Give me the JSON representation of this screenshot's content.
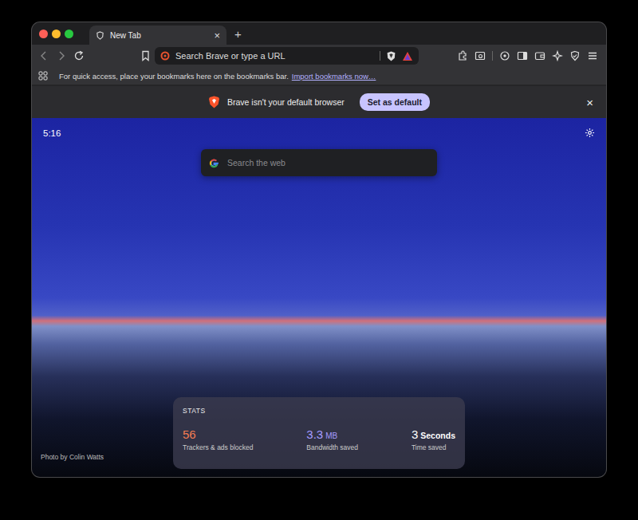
{
  "tabs": [
    {
      "label": "New Tab",
      "selected": true,
      "close": "×"
    }
  ],
  "new_tab_button": "+",
  "address_bar": {
    "placeholder": "Search Brave or type a URL"
  },
  "bookmarks_bar": {
    "message": "For quick access, place your bookmarks here on the bookmarks bar.",
    "link": "Import bookmarks now…"
  },
  "infobar": {
    "message": "Brave isn't your default browser",
    "button": "Set as default",
    "close": "×"
  },
  "new_tab_page": {
    "clock": "5:16",
    "search": {
      "placeholder": "Search the web"
    },
    "stats": {
      "title": "STATS",
      "items": [
        {
          "value": "56",
          "label": "Trackers & ads blocked",
          "color": "#f47c52"
        },
        {
          "value": "3.3",
          "unit": "MB",
          "label": "Bandwidth saved",
          "color": "#a59bff"
        },
        {
          "value": "3",
          "unit": "Seconds",
          "label": "Time saved",
          "color": "#ffffff"
        }
      ]
    },
    "photo_credit": "Photo by Colin Watts"
  }
}
